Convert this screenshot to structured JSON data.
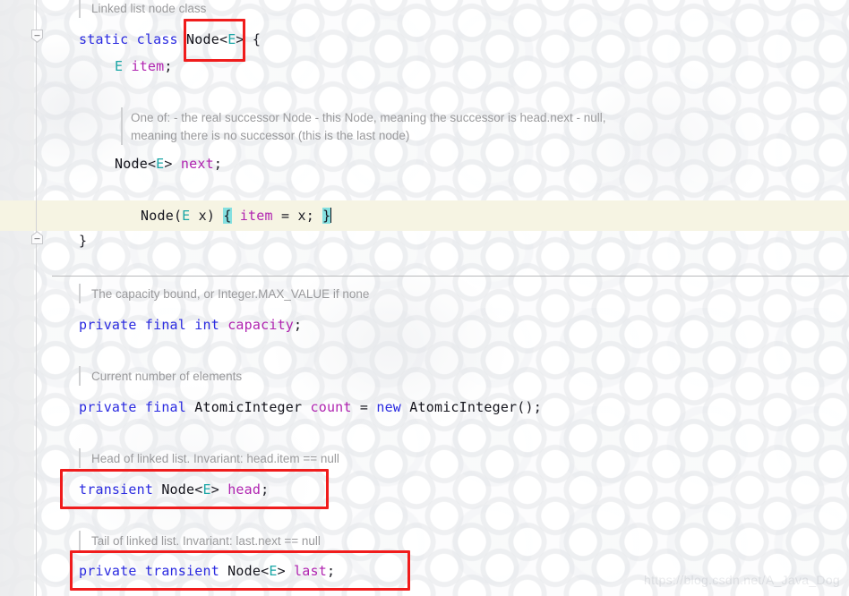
{
  "editor": {
    "watermark": "https://blog.csdn.net/A_Java_Dog",
    "colors": {
      "keyword": "#2a2ae0",
      "type": "#14141c",
      "generic": "#1aa6a6",
      "field": "#b024b0",
      "comment": "#9a9a9c",
      "current_line_bg": "#f6f4e3",
      "brace_match_bg": "#84e0e0",
      "annotation_box": "#f01c1c",
      "gutter_bg": "#e9eaec",
      "separator": "#b9babc"
    }
  },
  "doc_comments": {
    "node_class": "Linked list node class",
    "next_field_line1": "One of: - the real successor Node - this Node, meaning the successor is head.next - null,",
    "next_field_line2": "meaning there is no successor (this is the last node)",
    "capacity": "The capacity bound, or Integer.MAX_VALUE if none",
    "count": "Current number of elements",
    "head": "Head of linked list. Invariant: head.item == null",
    "last": "Tail of linked list. Invariant: last.next == null"
  },
  "code": {
    "class_decl": {
      "kw_static": "static",
      "kw_class": "class",
      "name": "Node",
      "lt": "<",
      "generic": "E",
      "gt": ">",
      "open_brace": "{"
    },
    "item_field": {
      "type": "E",
      "name": "item",
      "semi": ";"
    },
    "next_field": {
      "type": "Node",
      "lt": "<",
      "generic": "E",
      "gt": ">",
      "name": "next",
      "semi": ";"
    },
    "constructor": {
      "name": "Node",
      "paren_open": "(",
      "param_type": "E",
      "param_name": "x",
      "paren_close": ")",
      "open_brace": "{",
      "field": "item",
      "assign": "=",
      "value": "x",
      "semi": ";",
      "close_brace": "}"
    },
    "class_close": "}",
    "capacity_field": {
      "kw_private": "private",
      "kw_final": "final",
      "kw_int": "int",
      "name": "capacity",
      "semi": ";"
    },
    "count_field": {
      "kw_private": "private",
      "kw_final": "final",
      "type": "AtomicInteger",
      "name": "count",
      "assign": "=",
      "kw_new": "new",
      "ctor": "AtomicInteger",
      "parens": "()",
      "semi": ";"
    },
    "head_field": {
      "kw_transient": "transient",
      "type": "Node",
      "lt": "<",
      "generic": "E",
      "gt": ">",
      "name": "head",
      "semi": ";"
    },
    "last_field": {
      "kw_private": "private",
      "kw_transient": "transient",
      "type": "Node",
      "lt": "<",
      "generic": "E",
      "gt": ">",
      "name": "last",
      "semi": ";"
    }
  },
  "gutter": {
    "fold_marker_class": "collapse-class-fold",
    "fold_marker_end": "collapse-class-fold-end"
  },
  "annotations": {
    "box_node_type": "Node<E>",
    "box_head_decl": "transient Node<E> head;",
    "box_last_decl": "private transient Node<E> last;"
  }
}
